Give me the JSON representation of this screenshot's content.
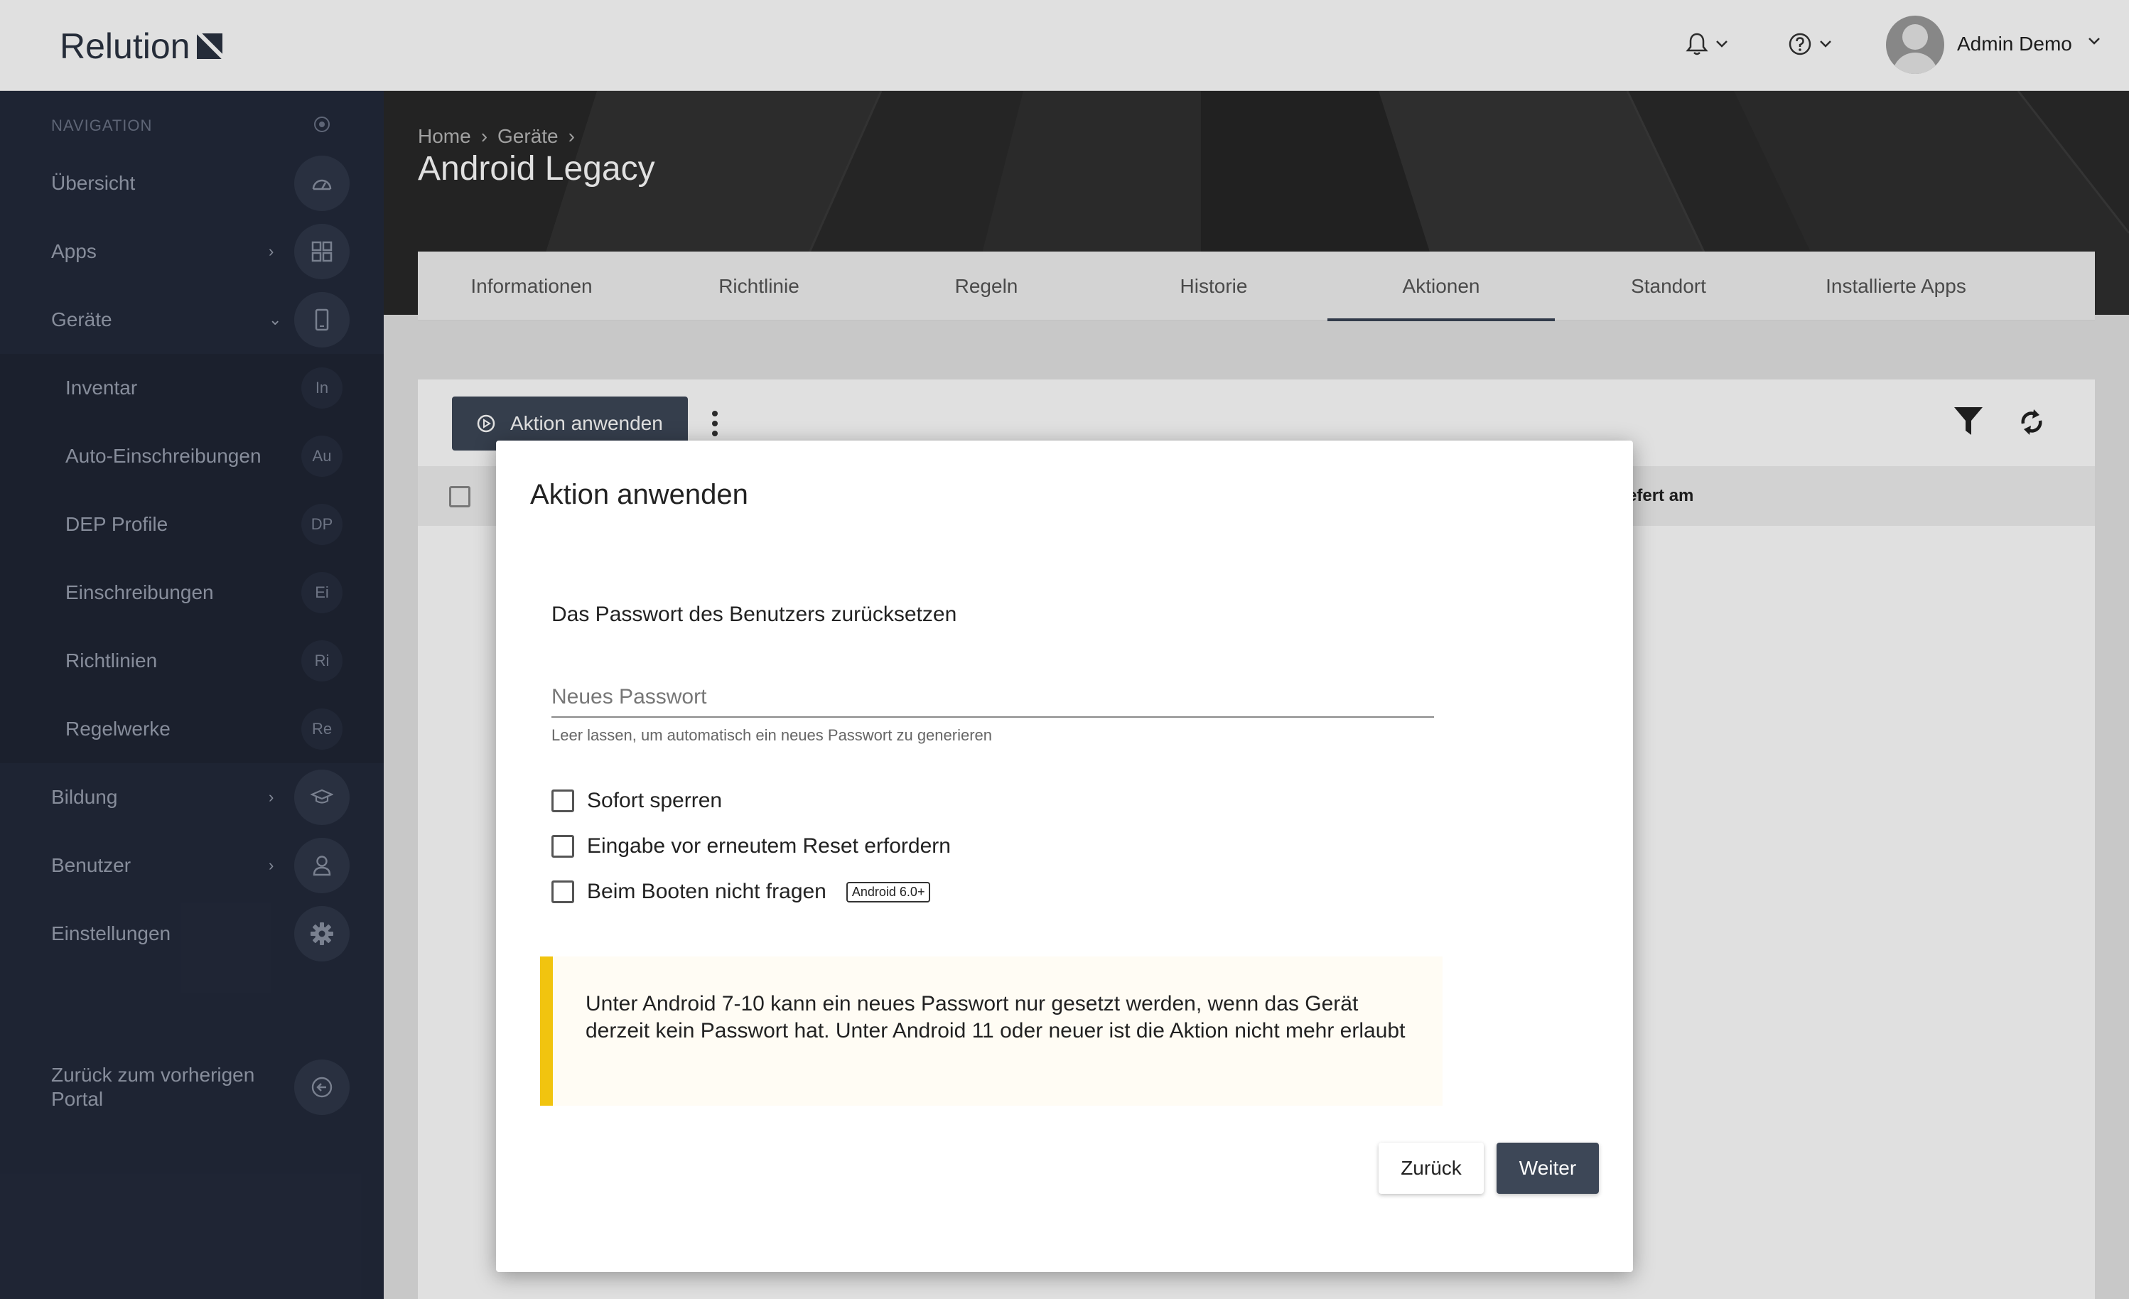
{
  "app": {
    "logo_text": "Relution"
  },
  "topbar": {
    "username": "Admin Demo"
  },
  "sidebar": {
    "header": "NAVIGATION",
    "items": [
      {
        "label": "Übersicht",
        "icon": "dashboard-icon"
      },
      {
        "label": "Apps",
        "icon": "apps-grid-icon"
      },
      {
        "label": "Geräte",
        "icon": "phone-icon"
      },
      {
        "label": "Bildung",
        "icon": "graduation-cap-icon"
      },
      {
        "label": "Benutzer",
        "icon": "user-icon"
      },
      {
        "label": "Einstellungen",
        "icon": "gear-icon"
      }
    ],
    "sub_items": [
      {
        "label": "Inventar",
        "abbr": "In"
      },
      {
        "label": "Auto-Einschreibungen",
        "abbr": "Au"
      },
      {
        "label": "DEP Profile",
        "abbr": "DP"
      },
      {
        "label": "Einschreibungen",
        "abbr": "Ei"
      },
      {
        "label": "Richtlinien",
        "abbr": "Ri"
      },
      {
        "label": "Regelwerke",
        "abbr": "Re"
      }
    ],
    "back_label_1": "Zurück zum vorherigen",
    "back_label_2": "Portal"
  },
  "header": {
    "breadcrumb": [
      "Home",
      "Geräte"
    ],
    "title": "Android Legacy"
  },
  "tabs": [
    "Informationen",
    "Richtlinie",
    "Regeln",
    "Historie",
    "Aktionen",
    "Standort",
    "Installierte Apps"
  ],
  "active_tab": "Aktionen",
  "toolbar": {
    "apply_label": "Aktion anwenden"
  },
  "table": {
    "visible_header": "efert am"
  },
  "modal": {
    "title": "Aktion anwenden",
    "subtitle": "Das Passwort des Benutzers zurücksetzen",
    "password_placeholder": "Neues Passwort",
    "password_value": "",
    "password_hint": "Leer lassen, um automatisch ein neues Passwort zu generieren",
    "checkboxes": [
      {
        "label": "Sofort sperren",
        "checked": false
      },
      {
        "label": "Eingabe vor erneutem Reset erfordern",
        "checked": false
      },
      {
        "label": "Beim Booten nicht fragen",
        "checked": false,
        "badge": "Android 6.0+"
      }
    ],
    "warning_text": "Unter Android 7-10 kann ein neues Passwort nur gesetzt werden, wenn das Gerät derzeit kein Passwort hat. Unter Android 11 oder neuer ist die Aktion nicht mehr erlaubt",
    "back_label": "Zurück",
    "next_label": "Weiter"
  },
  "colors": {
    "sidebar_bg": "#232a3b",
    "primary_button": "#3d4757",
    "warning_accent": "#f1c40f"
  }
}
